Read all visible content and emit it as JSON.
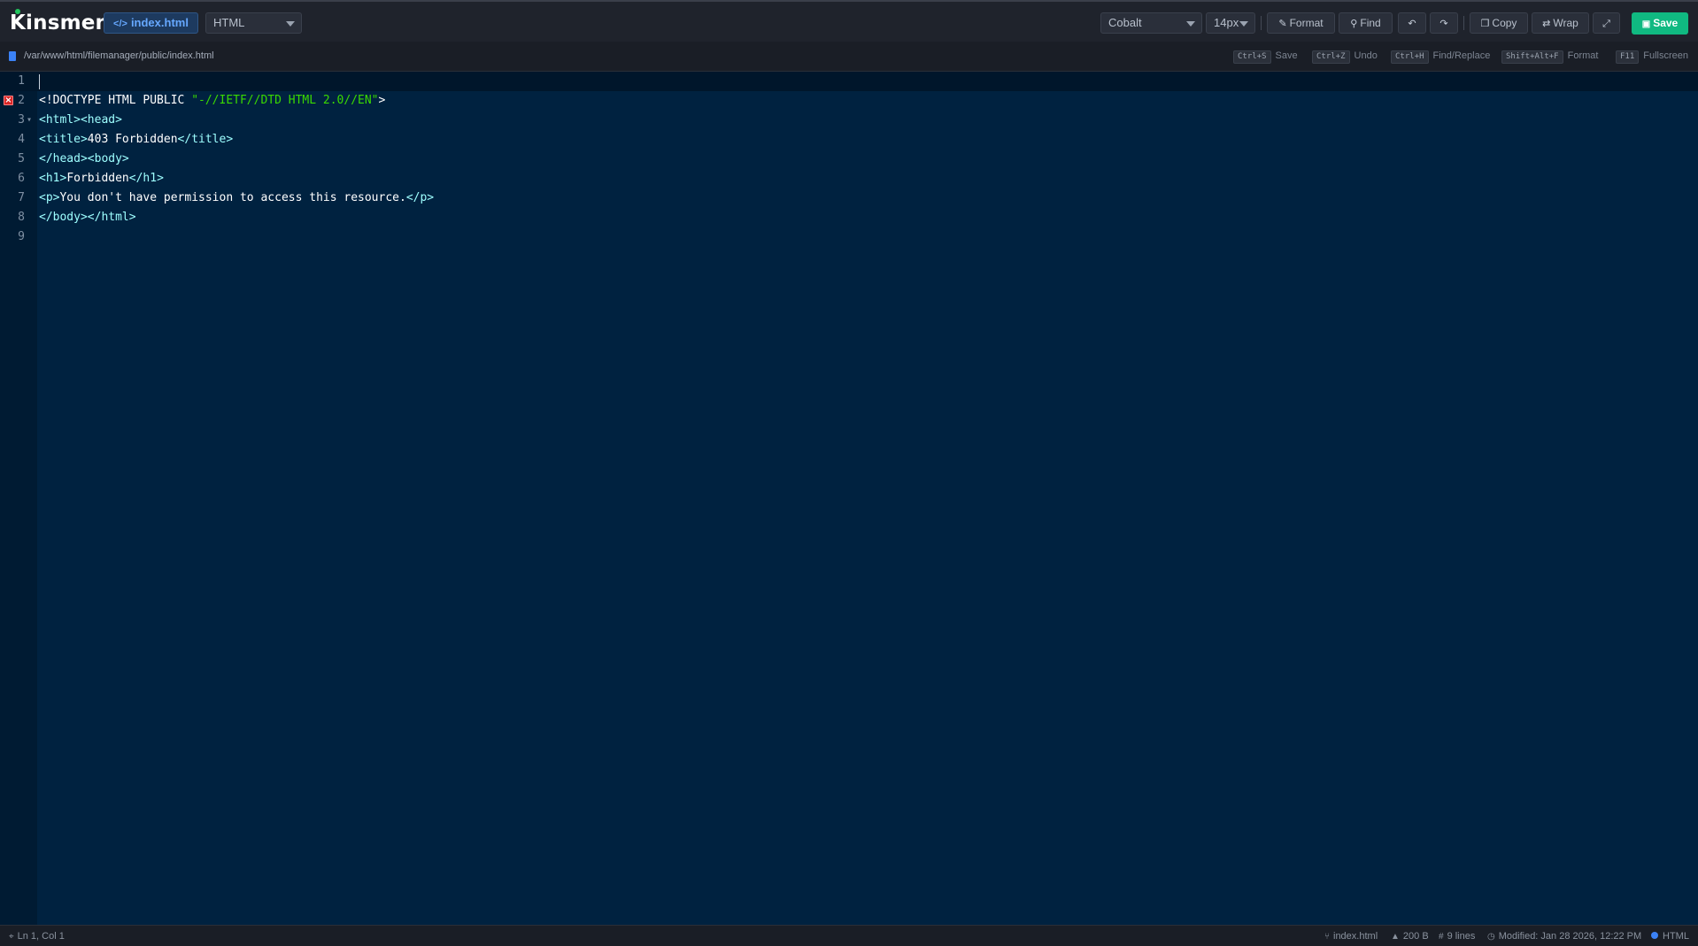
{
  "app": {
    "logo": "Kinsmen"
  },
  "file_tab": {
    "label": "index.html",
    "icon": "code-icon"
  },
  "language_select": {
    "value": "HTML"
  },
  "theme_select": {
    "value": "Cobalt"
  },
  "font_size_select": {
    "value": "14px"
  },
  "toolbar": {
    "format_label": "Format",
    "find_label": "Find",
    "copy_label": "Copy",
    "wrap_label": "Wrap",
    "save_label": "Save"
  },
  "path": "/var/www/html/filemanager/public/index.html",
  "shortcuts": [
    {
      "key": "Ctrl+S",
      "label": "Save"
    },
    {
      "key": "Ctrl+Z",
      "label": "Undo"
    },
    {
      "key": "Ctrl+H",
      "label": "Find/Replace"
    },
    {
      "key": "Shift+Alt+F",
      "label": "Format"
    },
    {
      "key": "F11",
      "label": "Fullscreen"
    }
  ],
  "editor": {
    "line_numbers": [
      "1",
      "2",
      "3",
      "4",
      "5",
      "6",
      "7",
      "8",
      "9"
    ],
    "lines": {
      "l2": {
        "doctype": "<!DOCTYPE HTML PUBLIC ",
        "str": "\"-//IETF//DTD HTML 2.0//EN\"",
        "end": ">"
      },
      "l3": {
        "tag": "<html><head>"
      },
      "l4": {
        "open": "<title>",
        "text": "403 Forbidden",
        "close": "</title>"
      },
      "l5": {
        "tag": "</head><body>"
      },
      "l6": {
        "open": "<h1>",
        "text": "Forbidden",
        "close": "</h1>"
      },
      "l7": {
        "open": "<p>",
        "text": "You don't have permission to access this resource.",
        "close": "</p>"
      },
      "l8": {
        "tag": "</body></html>"
      }
    }
  },
  "status": {
    "position": "Ln 1, Col 1",
    "filename": "index.html",
    "size": "200 B",
    "lines": "9 lines",
    "modified": "Modified: Jan 28 2026, 12:22 PM",
    "language": "HTML"
  },
  "colors": {
    "editor_bg": "#002240",
    "tag": "#9effff",
    "string": "#3ad900",
    "save_button": "#10b981",
    "accent": "#3b82f6"
  }
}
